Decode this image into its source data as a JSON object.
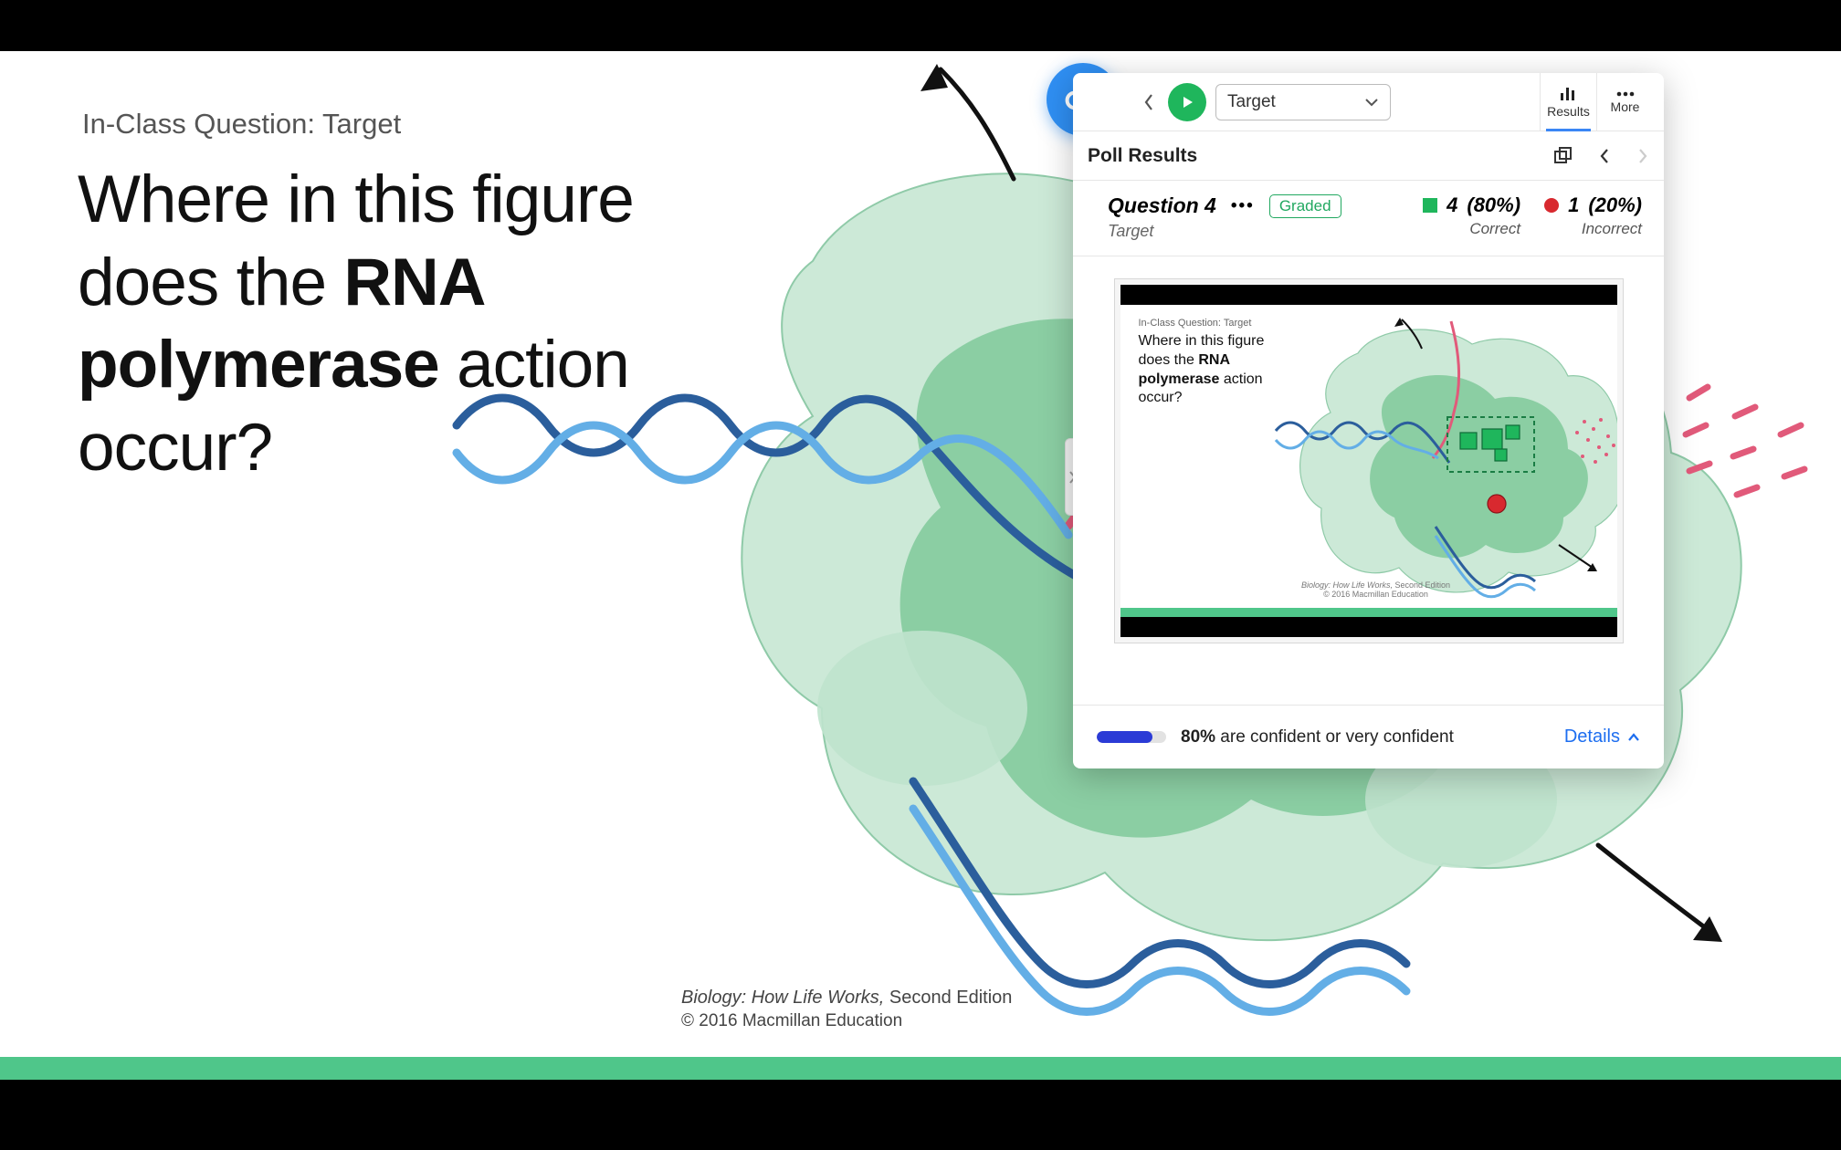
{
  "slide": {
    "label": "In-Class Question: Target",
    "question_pre": "Where in this figure does the ",
    "question_bold": "RNA polymerase",
    "question_post": " action occur?",
    "credit_title": "Biology: How Life Works,",
    "credit_edition": " Second Edition",
    "copyright": "© 2016 Macmillan Education"
  },
  "panel": {
    "target_select_label": "Target",
    "results_tab": "Results",
    "more_tab": "More",
    "poll_results_title": "Poll Results",
    "question_title": "Question 4",
    "question_subtitle": "Target",
    "graded_label": "Graded",
    "correct": {
      "count": "4",
      "pct": "(80%)",
      "label": "Correct"
    },
    "incorrect": {
      "count": "1",
      "pct": "(20%)",
      "label": "Incorrect"
    },
    "preview": {
      "label": "In-Class Question: Target",
      "q_pre": "Where in this figure does the ",
      "q_bold": "RNA polymerase",
      "q_post": " action occur?",
      "credit_title": "Biology: How Life Works,",
      "credit_edition": " Second Edition",
      "copyright": "© 2016 Macmillan Education"
    },
    "confidence": {
      "pct_text": "80%",
      "rest": " are confident or very confident",
      "fill_pct": 80
    },
    "details_label": "Details"
  },
  "colors": {
    "accent_green": "#4fc68a",
    "play_green": "#1fb65c",
    "cloud_blue": "#2f8ff3",
    "link_blue": "#1d6ef0",
    "correct_green": "#1fb65c",
    "incorrect_red": "#d8292f",
    "confidence_blue": "#2b3bd6"
  }
}
